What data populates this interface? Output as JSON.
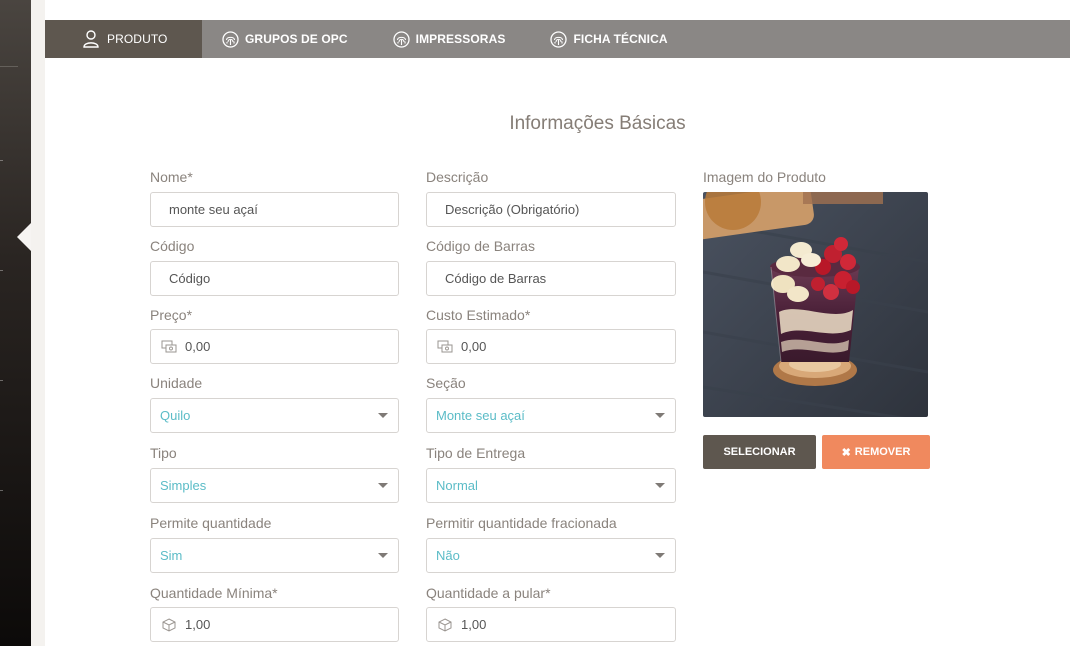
{
  "tabs": [
    {
      "label": "PRODUTO",
      "icon": "user-icon",
      "active": true
    },
    {
      "label": "GRUPOS DE OPC",
      "icon": "fingerprint-icon",
      "active": false
    },
    {
      "label": "IMPRESSORAS",
      "icon": "fingerprint-icon",
      "active": false
    },
    {
      "label": "FICHA TÉCNICA",
      "icon": "fingerprint-icon",
      "active": false
    }
  ],
  "section_title": "Informações Básicas",
  "form": {
    "nome": {
      "label": "Nome*",
      "value": "monte seu açaí"
    },
    "descricao": {
      "label": "Descrição",
      "placeholder": "Descrição (Obrigatório)"
    },
    "codigo": {
      "label": "Código",
      "placeholder": "Código"
    },
    "codigo_barras": {
      "label": "Código de Barras",
      "placeholder": "Código de Barras"
    },
    "preco": {
      "label": "Preço*",
      "value": "0,00",
      "icon": "money-icon"
    },
    "custo": {
      "label": "Custo Estimado*",
      "value": "0,00",
      "icon": "money-icon"
    },
    "unidade": {
      "label": "Unidade",
      "value": "Quilo"
    },
    "secao": {
      "label": "Seção",
      "value": "Monte seu açaí"
    },
    "tipo": {
      "label": "Tipo",
      "value": "Simples"
    },
    "tipo_entrega": {
      "label": "Tipo de Entrega",
      "value": "Normal"
    },
    "permite_qtd": {
      "label": "Permite quantidade",
      "value": "Sim"
    },
    "permite_frac": {
      "label": "Permitir quantidade fracionada",
      "value": "Não"
    },
    "qtd_min": {
      "label": "Quantidade Mínima*",
      "value": "1,00",
      "icon": "cube-icon"
    },
    "qtd_pular": {
      "label": "Quantidade a pular*",
      "value": "1,00",
      "icon": "cube-icon"
    }
  },
  "image": {
    "label": "Imagem do Produto",
    "select_label": "SELECIONAR",
    "remove_label": "REMOVER",
    "remove_icon": "close-icon"
  },
  "colors": {
    "tab_bar": "#8a8785",
    "tab_active": "#5e574f",
    "select_text": "#5bbcc7",
    "remove_button": "#f0895e",
    "select_button": "#5e574f"
  }
}
